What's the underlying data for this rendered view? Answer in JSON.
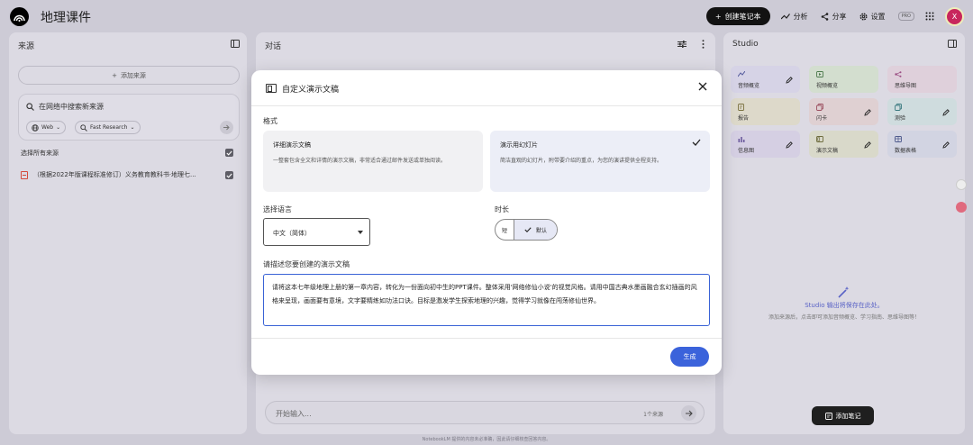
{
  "app": {
    "title": "地理课件"
  },
  "topbar": {
    "create_label": "创建笔记本",
    "analyze_label": "分析",
    "share_label": "分享",
    "settings_label": "设置",
    "pro_label": "PRO",
    "avatar_letter": "X"
  },
  "sources": {
    "title": "来源",
    "add_label": "添加来源",
    "search_placeholder": "在网络中搜索新来源",
    "chip_web": "Web",
    "chip_research": "Fast Research",
    "select_all": "选择所有来源",
    "items": [
      {
        "label": "（根据2022年版课程标准修订）义务教育教科书·地理七..."
      }
    ]
  },
  "chat": {
    "title": "对话",
    "input_placeholder": "开始输入...",
    "source_count": "1个来源"
  },
  "studio": {
    "title": "Studio",
    "tiles": [
      {
        "label": "音频概览",
        "bg": "#d6d3e6"
      },
      {
        "label": "视频概览",
        "bg": "#d3decf"
      },
      {
        "label": "思维导图",
        "bg": "#dfd0db"
      },
      {
        "label": "报告",
        "bg": "#ddd9ca"
      },
      {
        "label": "闪卡",
        "bg": "#dfd0d2"
      },
      {
        "label": "测验",
        "bg": "#cfdcde"
      },
      {
        "label": "信息图",
        "bg": "#d5cfe3"
      },
      {
        "label": "演示文稿",
        "bg": "#d9d9ca"
      },
      {
        "label": "数据表格",
        "bg": "#d2d4e2"
      }
    ],
    "empty_title": "Studio 输出将保存在此处。",
    "empty_sub": "添加来源后，点击即可添加音频概览、学习指南、思维导图等！",
    "add_note_label": "添加笔记"
  },
  "footer": "NotebookLM 提供的内容未必准确，因此请仔细核查回答内容。",
  "dialog": {
    "title": "自定义演示文稿",
    "format_label": "格式",
    "formats": [
      {
        "title": "详细演示文稿",
        "desc": "一整套包含全文和详情的演示文稿，非常适合通过邮件发送或单独阅读。",
        "selected": false
      },
      {
        "title": "演示用幻灯片",
        "desc": "简洁直观的幻灯片，附带要介绍的重点，为您的演讲提供全程支持。",
        "selected": true
      }
    ],
    "language_label": "选择语言",
    "language_value": "中文（简体）",
    "length_label": "时长",
    "length_short": "短",
    "length_default": "默认",
    "describe_label": "请描述您要创建的演示文稿",
    "describe_value": "请将这本七年级地理上册的第一章内容，转化为一份面向初中生的PPT课件。整体采用'网络修仙小说'的视觉风格。请用中国古典水墨画融合玄幻插画的风格来呈现，画面要有意境，文字要精练如功法口诀。目标是激发学生探索地理的兴趣，觉得学习就像在闯荡修仙世界。",
    "generate_label": "生成"
  },
  "colors": {
    "accent": "#3b63db",
    "selected_card": "#eceef7",
    "unselected_card": "#f1f1f3"
  }
}
